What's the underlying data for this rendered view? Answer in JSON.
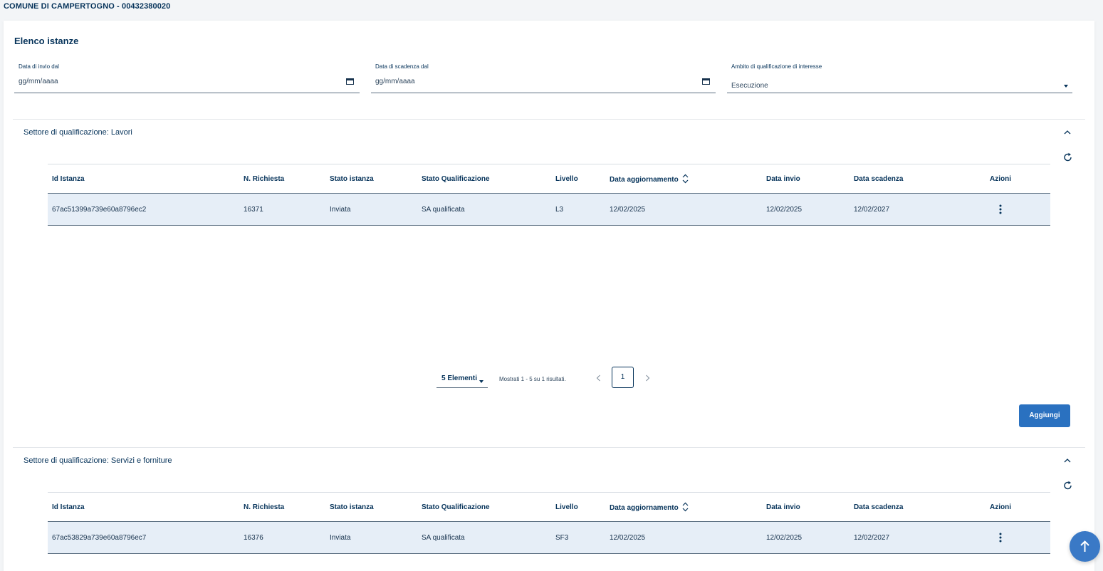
{
  "header": {
    "org": "COMUNE DI CAMPERTOGNO - 00432380020"
  },
  "page": {
    "title": "Elenco istanze"
  },
  "filters": [
    {
      "label": "Data di invio dal",
      "value": "gg/mm/aaaa",
      "icon": "calendar-icon"
    },
    {
      "label": "Data di scadenza dal",
      "value": "gg/mm/aaaa",
      "icon": "calendar-icon"
    },
    {
      "label": "Ambito di qualificazione di interesse",
      "value": "Esecuzione",
      "icon": "caret-down-icon"
    }
  ],
  "columns": [
    "Id Istanza",
    "N. Richiesta",
    "Stato istanza",
    "Stato Qualificazione",
    "Livello",
    "Data aggiornamento",
    "Data invio",
    "Data scadenza",
    "Azioni"
  ],
  "sections": [
    {
      "title": "Settore di qualificazione: Lavori",
      "rows": [
        {
          "id": "67ac51399a739e60a8796ec2",
          "n_richiesta": "16371",
          "stato_istanza": "Inviata",
          "stato_qualificazione": "SA qualificata",
          "livello": "L3",
          "data_aggiornamento": "12/02/2025",
          "data_invio": "12/02/2025",
          "data_scadenza": "12/02/2027"
        }
      ]
    },
    {
      "title": "Settore di qualificazione: Servizi e forniture",
      "rows": [
        {
          "id": "67ac53829a739e60a8796ec7",
          "n_richiesta": "16376",
          "stato_istanza": "Inviata",
          "stato_qualificazione": "SA qualificata",
          "livello": "SF3",
          "data_aggiornamento": "12/02/2025",
          "data_invio": "12/02/2025",
          "data_scadenza": "12/02/2027"
        }
      ]
    }
  ],
  "pagination": {
    "page_size_label": "5 Elementi",
    "info": "Mostrati 1 - 5 su 1 risultati.",
    "current_page": "1"
  },
  "actions": {
    "add_label": "Aggiungi"
  },
  "colors": {
    "primary": "#06335a",
    "button": "#2a71c0",
    "row_bg": "#e6eef7"
  }
}
